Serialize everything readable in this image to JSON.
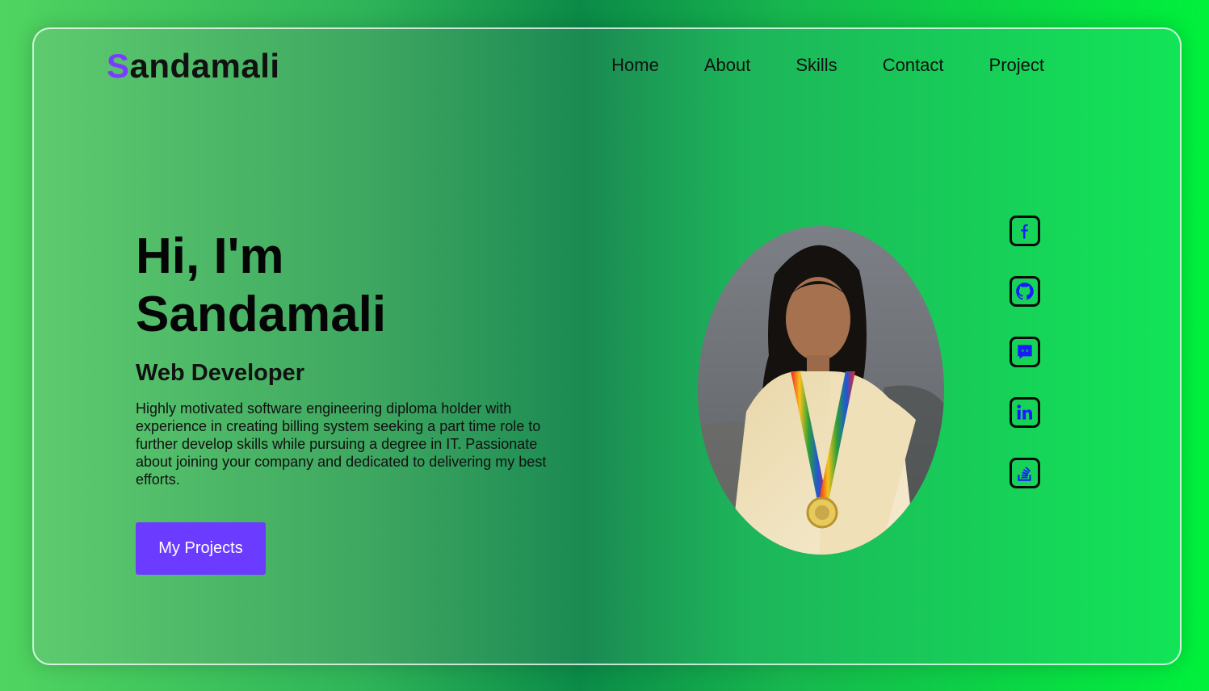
{
  "brand": {
    "first_letter": "S",
    "rest": "andamali",
    "accent_color": "#7b3cff"
  },
  "nav": {
    "items": [
      {
        "label": "Home"
      },
      {
        "label": "About"
      },
      {
        "label": "Skills"
      },
      {
        "label": "Contact"
      },
      {
        "label": "Project"
      }
    ]
  },
  "hero": {
    "greeting_line1": "Hi, I'm",
    "greeting_line2": "Sandamali",
    "role": "Web Developer",
    "description": "Highly motivated software engineering diploma holder with experience in creating billing system seeking a part time role to further develop skills while pursuing a degree in IT. Passionate about joining your company and dedicated to delivering my best efforts.",
    "cta_label": "My Projects",
    "cta_color": "#6b3bff"
  },
  "socials": {
    "icons": [
      "facebook-icon",
      "github-icon",
      "discord-icon",
      "linkedin-icon",
      "stackoverflow-icon"
    ],
    "icon_color": "#1a1aff"
  }
}
